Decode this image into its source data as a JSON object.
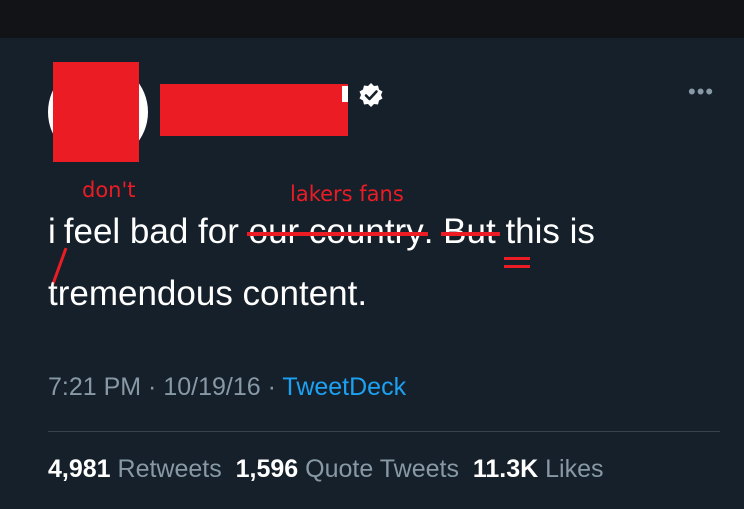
{
  "tweet": {
    "text_prefix": "i",
    "text_middle": "feel bad for ",
    "struck_1": "our country",
    "after_struck": ". ",
    "struck_2": "But",
    "space": " ",
    "th": "th",
    "text_rest_line1": "is is",
    "line2": "tremendous content."
  },
  "annotations": {
    "inserted_word": "don't",
    "replacement": "lakers fans"
  },
  "meta": {
    "time": "7:21 PM",
    "sep1": " · ",
    "date": "10/19/16",
    "sep2": " · ",
    "source": "TweetDeck"
  },
  "stats": {
    "retweets_count": "4,981",
    "retweets_label": "Retweets",
    "quotes_count": "1,596",
    "quotes_label": "Quote Tweets",
    "likes_count": "11.3K",
    "likes_label": "Likes"
  },
  "icons": {
    "verified": "verified-icon",
    "more": "more-icon"
  },
  "colors": {
    "background": "#15202b",
    "annotation_red": "#ec1c24",
    "link_blue": "#1da1f2",
    "muted": "#8899a6"
  }
}
